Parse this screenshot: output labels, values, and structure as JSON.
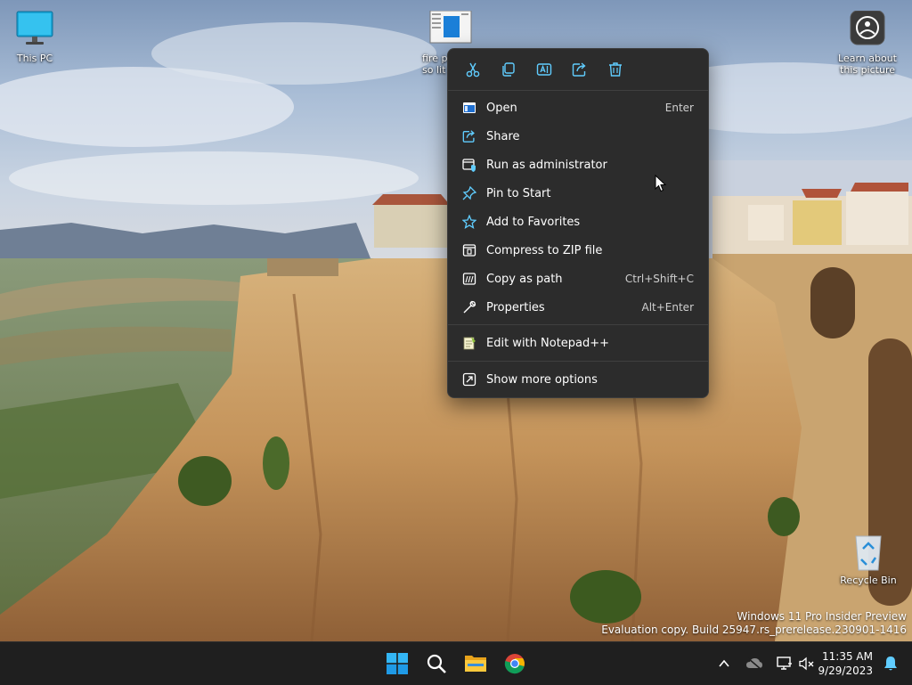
{
  "desktop": {
    "icons": [
      {
        "label": "This PC"
      },
      {
        "label": "fire p\nso lit"
      },
      {
        "label": "Learn about\nthis picture"
      },
      {
        "label": "Recycle Bin"
      }
    ]
  },
  "watermark": {
    "line1": "Windows 11 Pro Insider Preview",
    "line2": "Evaluation copy. Build 25947.rs_prerelease.230901-1416"
  },
  "context_menu": {
    "quick_actions": [
      {
        "icon": "cut-icon",
        "label": "Cut"
      },
      {
        "icon": "copy-icon",
        "label": "Copy"
      },
      {
        "icon": "rename-icon",
        "label": "Rename"
      },
      {
        "icon": "share-icon",
        "label": "Share"
      },
      {
        "icon": "delete-icon",
        "label": "Delete"
      }
    ],
    "items": [
      {
        "label": "Open",
        "shortcut": "Enter",
        "icon": "open-icon"
      },
      {
        "label": "Share",
        "shortcut": "",
        "icon": "share-icon"
      },
      {
        "label": "Run as administrator",
        "shortcut": "",
        "icon": "shield-icon"
      },
      {
        "label": "Pin to Start",
        "shortcut": "",
        "icon": "pin-icon"
      },
      {
        "label": "Add to Favorites",
        "shortcut": "",
        "icon": "star-icon"
      },
      {
        "label": "Compress to ZIP file",
        "shortcut": "",
        "icon": "zip-icon"
      },
      {
        "label": "Copy as path",
        "shortcut": "Ctrl+Shift+C",
        "icon": "path-icon"
      },
      {
        "label": "Properties",
        "shortcut": "Alt+Enter",
        "icon": "wrench-icon"
      },
      {
        "label": "Edit with Notepad++",
        "shortcut": "",
        "icon": "notepad-icon"
      },
      {
        "label": "Show more options",
        "shortcut": "",
        "icon": "more-options-icon"
      }
    ]
  },
  "taskbar": {
    "apps": [
      {
        "icon": "windows-start-icon"
      },
      {
        "icon": "search-icon"
      },
      {
        "icon": "file-explorer-icon"
      },
      {
        "icon": "chrome-icon"
      }
    ],
    "tray": [
      "chevron-up-icon",
      "cloud-icon",
      "network-icon",
      "volume-muted-icon"
    ],
    "clock": {
      "time": "11:35 AM",
      "date": "9/29/2023"
    }
  },
  "colors": {
    "menu_bg": "#2c2c2c",
    "taskbar_bg": "#1f1f1f",
    "accent": "#60cdff"
  }
}
